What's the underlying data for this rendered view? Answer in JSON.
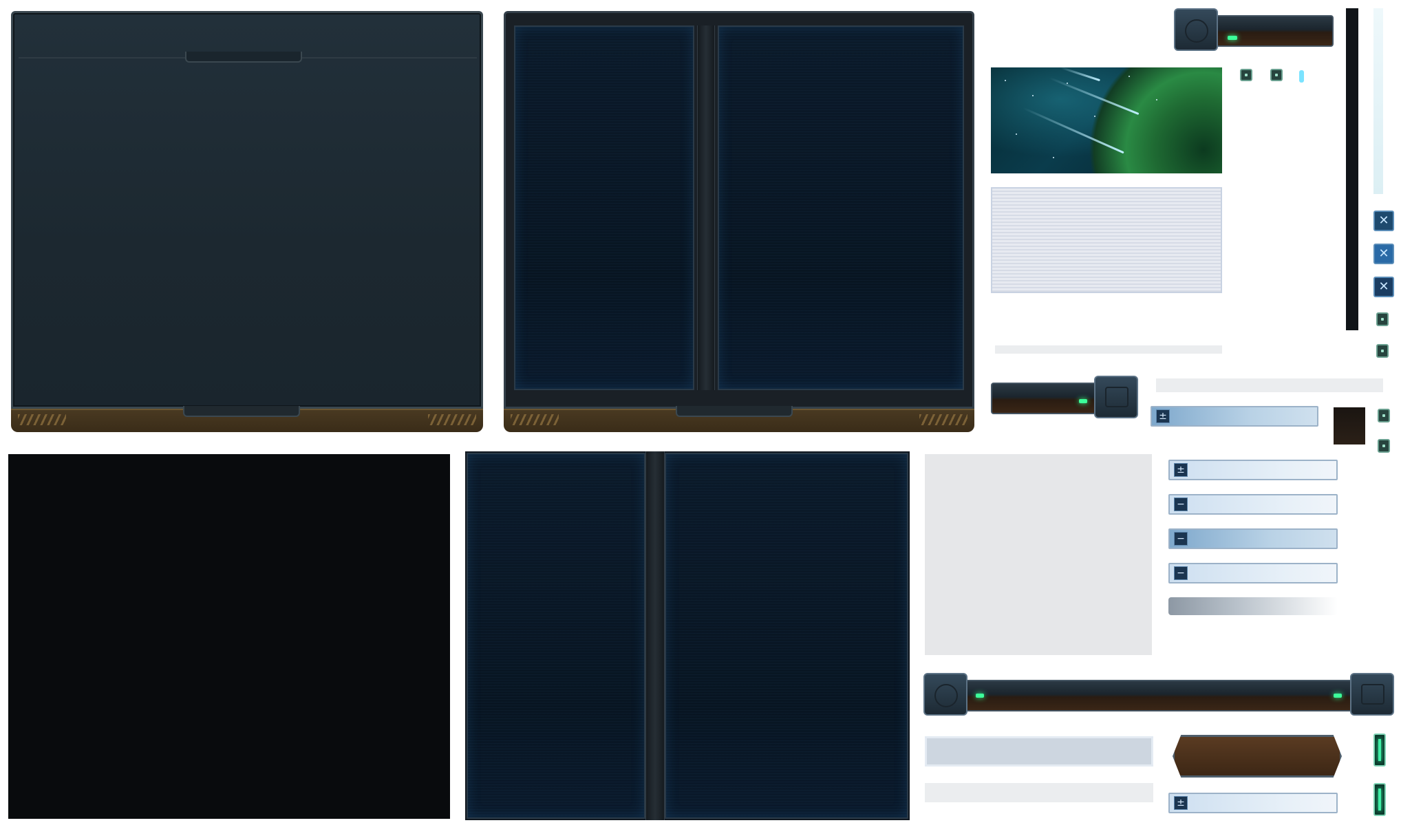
{
  "sheet": {
    "description_items": [
      "metal-panel-left",
      "blue-split-panel-right",
      "black-panel",
      "blue-split-panel-bottom",
      "planet-thumbnail",
      "lined-list-box",
      "mechanical-bars",
      "tree-rows",
      "close-buttons",
      "status-cells"
    ]
  },
  "tree_rows": [
    {
      "sign": "±",
      "style": "strong"
    },
    {
      "sign": "±",
      "style": "light"
    },
    {
      "sign": "−",
      "style": "light"
    },
    {
      "sign": "−",
      "style": "strong"
    },
    {
      "sign": "−",
      "style": "light"
    },
    {
      "sign": "±",
      "style": "light"
    }
  ],
  "icons": {
    "close": "✕",
    "plus": "±",
    "minus": "−"
  },
  "colors": {
    "panel_metal": "#1c2830",
    "screen_blue": "#081522",
    "bronze": "#4a3a22",
    "accent_green": "#3cff9a",
    "accent_cyan": "#7be3ff"
  }
}
